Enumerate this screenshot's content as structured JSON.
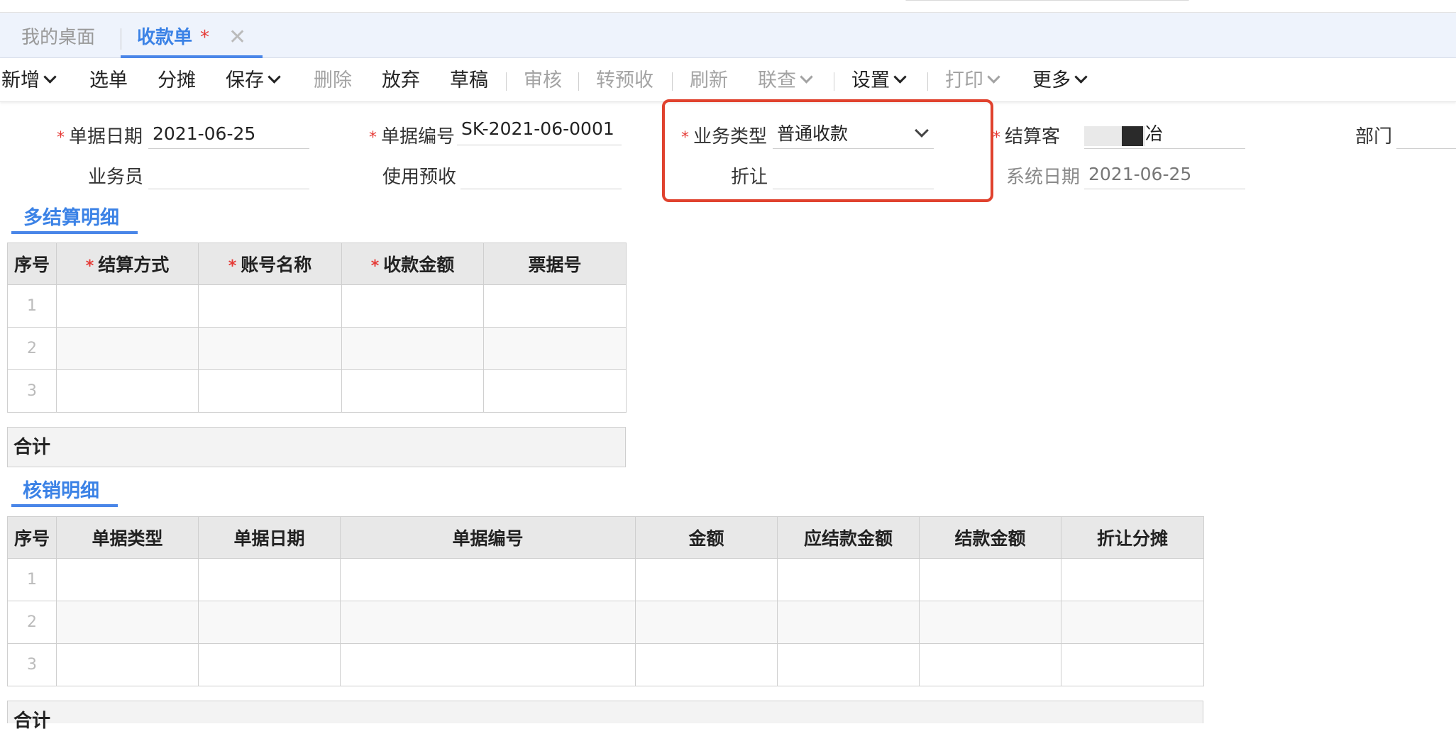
{
  "tabs": {
    "desktop": "我的桌面",
    "active": {
      "label": "收款单",
      "modified_mark": "*",
      "close_icon": "✕"
    }
  },
  "toolbar": {
    "add": "新增",
    "select": "选单",
    "allocate": "分摊",
    "save": "保存",
    "delete": "删除",
    "abandon": "放弃",
    "draft": "草稿",
    "audit": "审核",
    "to_prepay": "转预收",
    "refresh": "刷新",
    "link_query": "联查",
    "settings": "设置",
    "print": "打印",
    "more": "更多",
    "separator": "|"
  },
  "form": {
    "required_mark": "*",
    "doc_date": {
      "label": "单据日期",
      "value": "2021-06-25"
    },
    "doc_no": {
      "label": "单据编号",
      "value": "SK-2021-06-0001"
    },
    "biz_type": {
      "label": "业务类型",
      "value": "普通收款"
    },
    "settle_customer": {
      "label": "结算客",
      "value": "冶"
    },
    "department": {
      "label": "部门",
      "value": ""
    },
    "salesman": {
      "label": "业务员",
      "value": ""
    },
    "use_prepay": {
      "label": "使用预收",
      "value": ""
    },
    "discount": {
      "label": "折让",
      "value": ""
    },
    "sys_date": {
      "label": "系统日期",
      "value": "2021-06-25"
    }
  },
  "settlement_section": {
    "title": "多结算明细",
    "columns": [
      "序号",
      "结算方式",
      "账号名称",
      "收款金额",
      "票据号"
    ],
    "required_columns": [
      false,
      true,
      true,
      true,
      false
    ],
    "rows": [
      {
        "idx": "1",
        "cells": [
          "",
          "",
          "",
          ""
        ]
      },
      {
        "idx": "2",
        "cells": [
          "",
          "",
          "",
          ""
        ]
      },
      {
        "idx": "3",
        "cells": [
          "",
          "",
          "",
          ""
        ]
      }
    ],
    "total_label": "合计"
  },
  "writeoff_section": {
    "title": "核销明细",
    "columns": [
      "序号",
      "单据类型",
      "单据日期",
      "单据编号",
      "金额",
      "应结款金额",
      "结款金额",
      "折让分摊"
    ],
    "rows": [
      {
        "idx": "1",
        "cells": [
          "",
          "",
          "",
          "",
          "",
          "",
          ""
        ]
      },
      {
        "idx": "2",
        "cells": [
          "",
          "",
          "",
          "",
          "",
          "",
          ""
        ]
      },
      {
        "idx": "3",
        "cells": [
          "",
          "",
          "",
          "",
          "",
          "",
          ""
        ]
      }
    ],
    "total_label": "合计"
  },
  "colors": {
    "accent": "#3b82e6",
    "required": "#e53935",
    "highlight_box": "#e0422e",
    "tab_bar_bg": "#eef3fc",
    "disabled_text": "#a3a3a3"
  }
}
